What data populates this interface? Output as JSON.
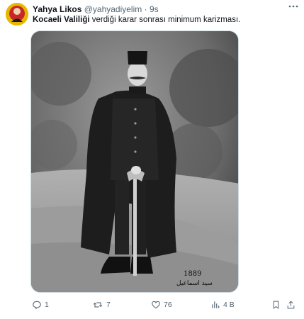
{
  "author": {
    "display_name": "Yahya Likos",
    "handle": "@yahyadiyelim",
    "separator": "·",
    "time_ago": "9s"
  },
  "tweet": {
    "highlight": "Kocaeli Valiliği",
    "text": " verdiği karar sonrası minimum karizması."
  },
  "media": {
    "photo_caption": "1889",
    "photo_script": "سید اسماعیل"
  },
  "actions": {
    "replies": "1",
    "retweets": "7",
    "likes": "76",
    "views": "4 B"
  },
  "colors": {
    "text": "#0f1419",
    "secondary": "#536471",
    "border": "#cfd9de"
  },
  "icons": {
    "more": "more-dots-icon",
    "reply": "reply-icon",
    "retweet": "retweet-icon",
    "like": "heart-icon",
    "views": "views-icon",
    "bookmark": "bookmark-icon",
    "share": "share-icon"
  }
}
